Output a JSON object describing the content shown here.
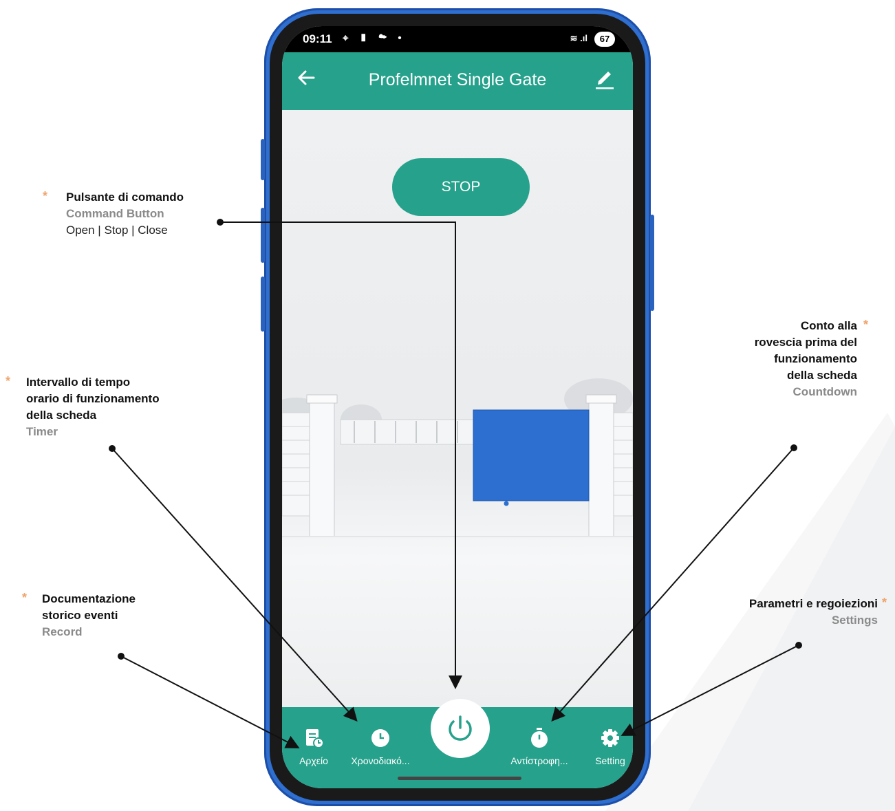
{
  "status_bar": {
    "time": "09:11",
    "left_icons": "⌖ ▮ ☁ •",
    "right_icons": "≋ .ıl",
    "battery": "67"
  },
  "app_bar": {
    "title": "Profelmnet Single Gate",
    "back_icon": "arrow-left-icon",
    "edit_icon": "pencil-icon"
  },
  "stop_button": {
    "label": "STOP"
  },
  "bottom_nav": [
    {
      "label": "Αρχείο",
      "icon": "record-icon"
    },
    {
      "label": "Χρονοδιακό...",
      "icon": "clock-icon"
    },
    {
      "label": "",
      "icon": "power-icon"
    },
    {
      "label": "Αντίστροφη...",
      "icon": "stopwatch-icon"
    },
    {
      "label": "Setting",
      "icon": "gear-icon"
    }
  ],
  "annotations": {
    "command": {
      "title": "Pulsante di comando",
      "subtitle": "Command Button",
      "extra": "Open | Stop | Close"
    },
    "timer": {
      "line1": "Intervallo di tempo",
      "line2": "orario di funzionamento",
      "line3": "della scheda",
      "subtitle": "Timer"
    },
    "record": {
      "line1": "Documentazione",
      "line2": "storico eventi",
      "subtitle": "Record"
    },
    "countdown": {
      "line1": "Conto alla",
      "line2": "rovescia prima del",
      "line3": "funzionamento",
      "line4": "della scheda",
      "subtitle": "Countdown"
    },
    "settings": {
      "title": "Parametri e regoiezioni",
      "subtitle": "Settings"
    }
  },
  "colors": {
    "teal": "#26a18b",
    "phone_blue": "#2f6fd0",
    "star": "#f0a36b",
    "gate_blue": "#2c6fd0"
  }
}
